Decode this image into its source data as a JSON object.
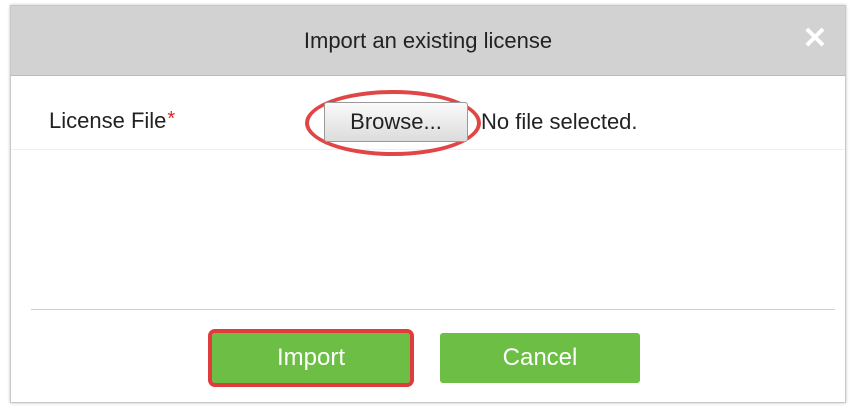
{
  "dialog": {
    "title": "Import an existing license",
    "close_icon": "close-icon",
    "close_glyph": "✕"
  },
  "form": {
    "license_label": "License File",
    "required_marker": "*",
    "browse_label": "Browse...",
    "file_status": "No file selected."
  },
  "buttons": {
    "import_label": "Import",
    "cancel_label": "Cancel"
  },
  "colors": {
    "titlebar": "#d2d2d2",
    "button_green": "#6dbe45",
    "highlight_red": "#e03c3c"
  }
}
